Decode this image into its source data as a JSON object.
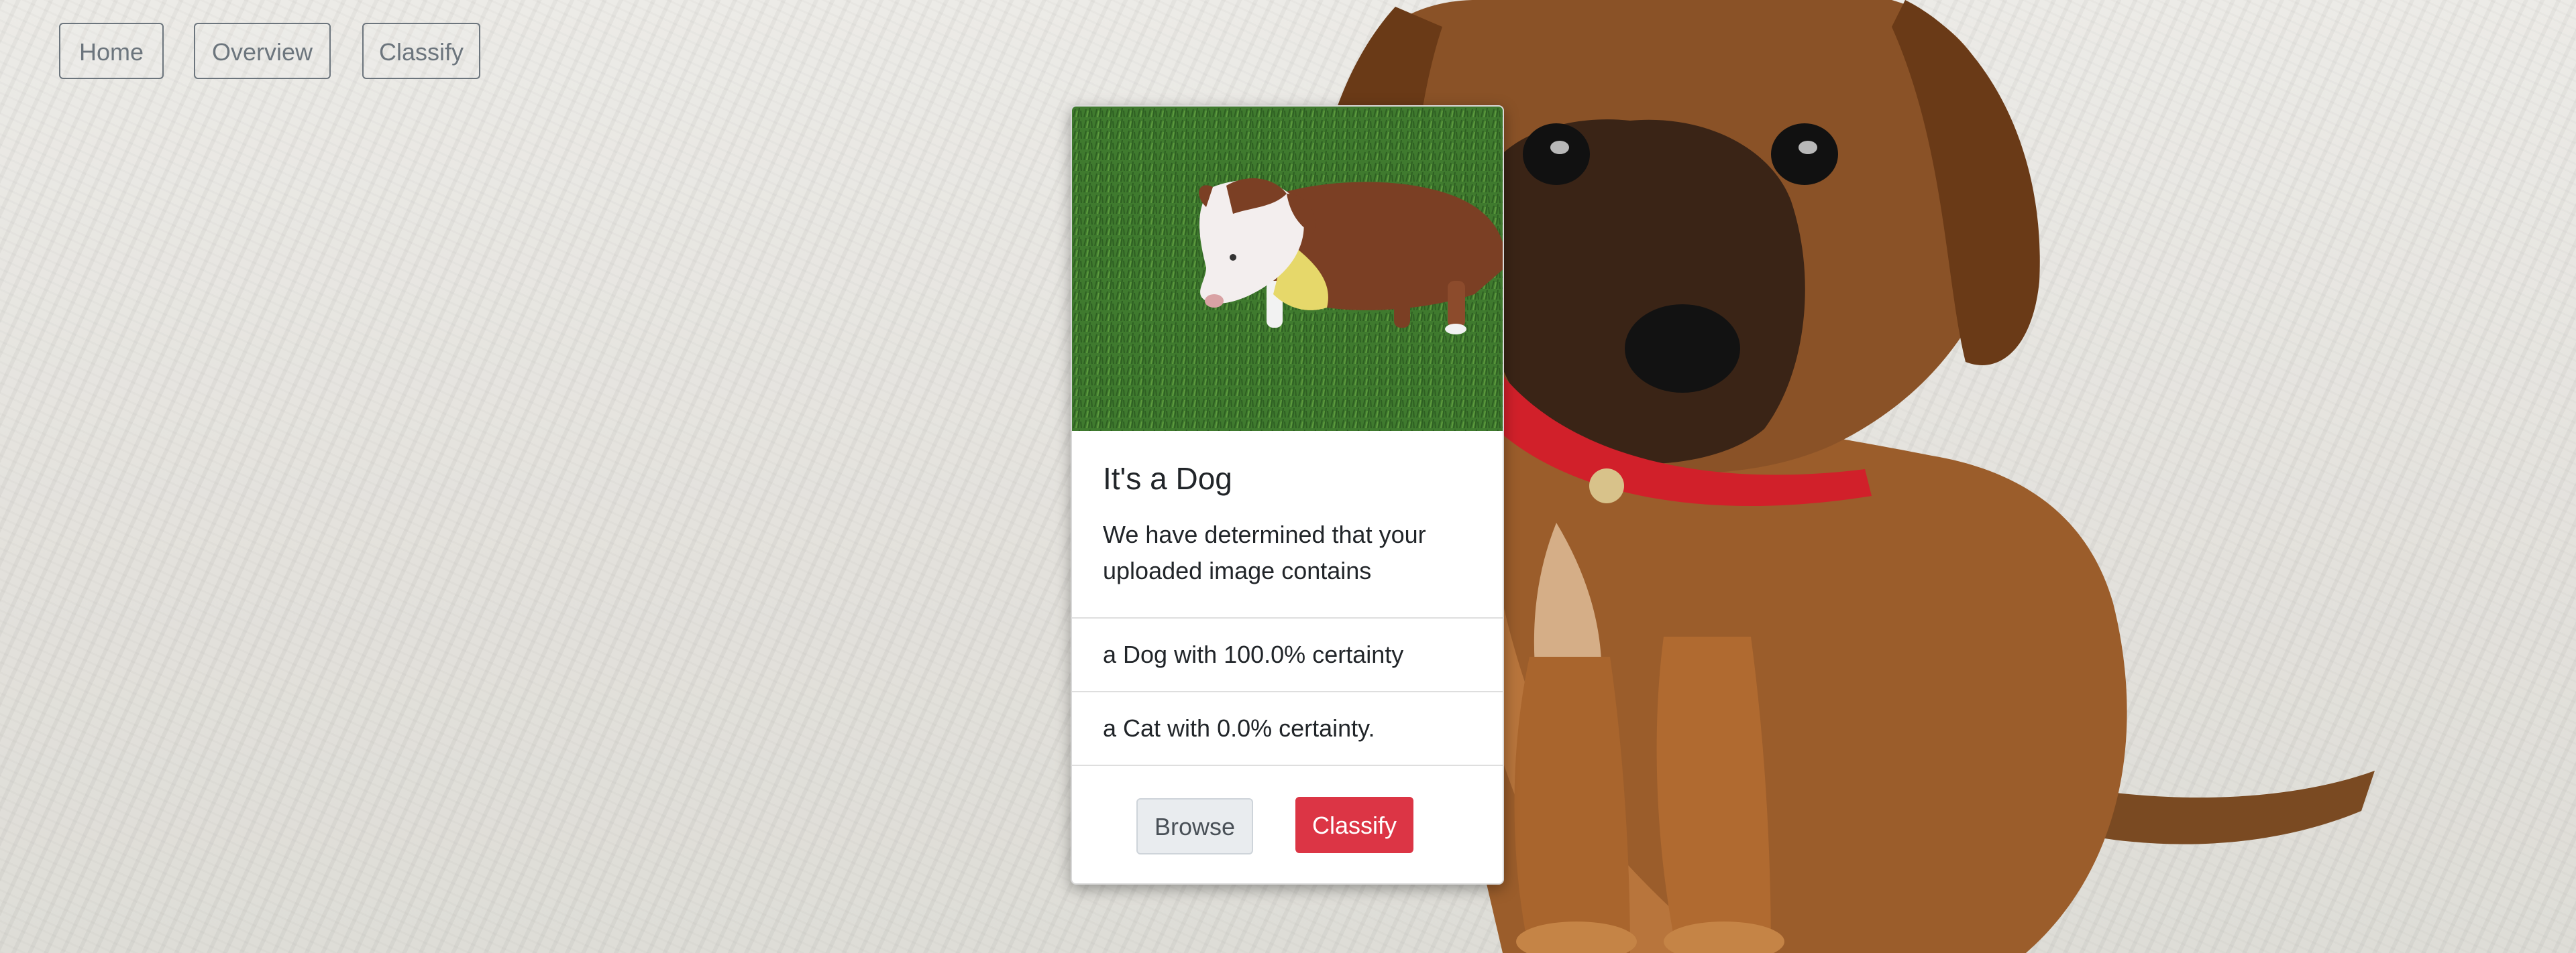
{
  "nav": {
    "home": "Home",
    "overview": "Overview",
    "classify": "Classify"
  },
  "card": {
    "title": "It's a Dog",
    "text": "We have determined that your uploaded image contains",
    "results": [
      "a Dog with 100.0% certainty",
      "a Cat with 0.0% certainty."
    ],
    "browse_label": "Browse",
    "classify_label": "Classify"
  },
  "colors": {
    "accent_danger": "#dc3545",
    "nav_outline": "#6c757d"
  }
}
